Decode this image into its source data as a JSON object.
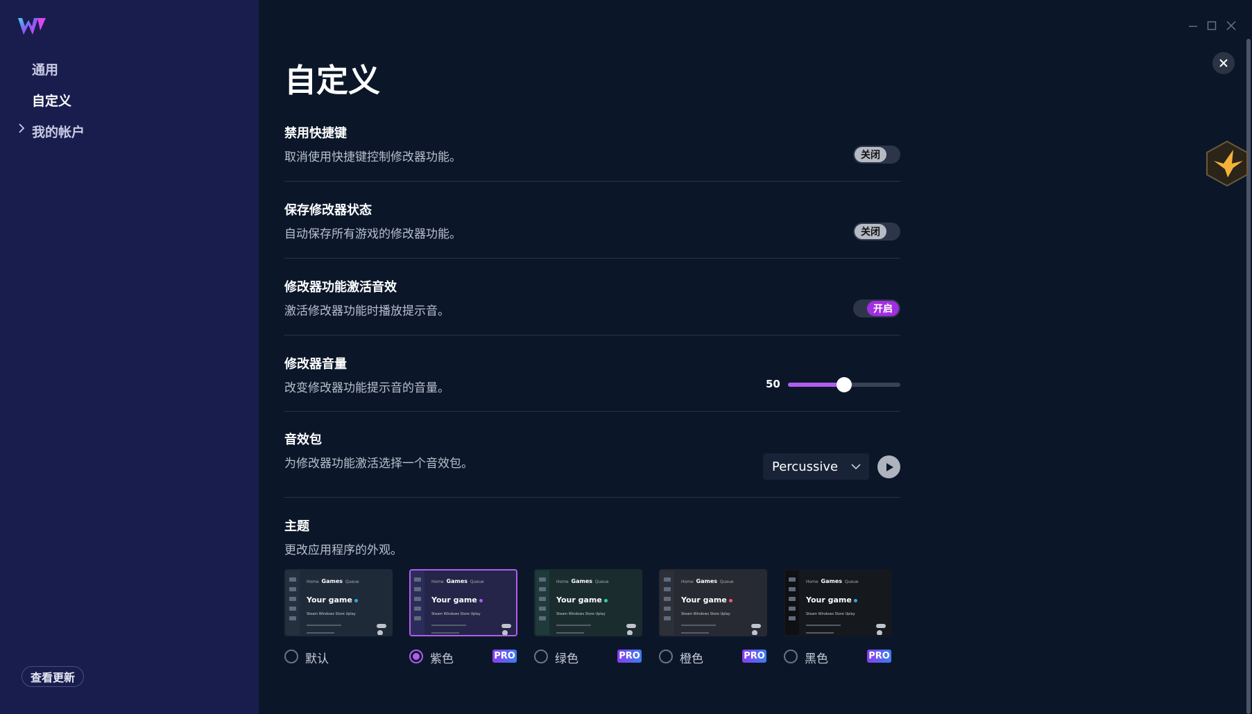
{
  "sidebar": {
    "items": [
      {
        "label": "通用"
      },
      {
        "label": "自定义"
      },
      {
        "label": "我的帐户"
      }
    ],
    "update_button": "查看更新"
  },
  "page": {
    "title": "自定义"
  },
  "settings": {
    "hotkeys": {
      "title": "禁用快捷键",
      "desc": "取消使用快捷键控制修改器功能。",
      "state": "关闭"
    },
    "save_state": {
      "title": "保存修改器状态",
      "desc": "自动保存所有游戏的修改器功能。",
      "state": "关闭"
    },
    "sound": {
      "title": "修改器功能激活音效",
      "desc": "激活修改器功能时播放提示音。",
      "state": "开启"
    },
    "volume": {
      "title": "修改器音量",
      "desc": "改变修改器功能提示音的音量。",
      "value": "50",
      "percent": 50
    },
    "sound_pack": {
      "title": "音效包",
      "desc": "为修改器功能激活选择一个音效包。",
      "selected": "Percussive"
    },
    "theme": {
      "title": "主题",
      "desc": "更改应用程序的外观。",
      "preview": {
        "nav_home": "Home",
        "nav_games": "Games",
        "nav_queue": "Queue",
        "game_title": "Your game",
        "stores": "Steam   Windows Store   Uplay"
      },
      "options": [
        {
          "label": "默认",
          "pro": "",
          "accent": "#2fa8e6",
          "bg": "#1f2a38",
          "side": "#25303f",
          "checked": false
        },
        {
          "label": "紫色",
          "pro": "PRO",
          "accent": "#b25cf0",
          "bg": "#242548",
          "side": "#2c2c5a",
          "checked": true
        },
        {
          "label": "绿色",
          "pro": "PRO",
          "accent": "#2cd6a4",
          "bg": "#1b2c2e",
          "side": "#1f3a3a",
          "checked": false
        },
        {
          "label": "橙色",
          "pro": "PRO",
          "accent": "#ff5a5a",
          "bg": "#272a32",
          "side": "#2d3039",
          "checked": false
        },
        {
          "label": "黑色",
          "pro": "PRO",
          "accent": "#2fa8e6",
          "bg": "#15181c",
          "side": "#0e1013",
          "checked": false
        }
      ]
    }
  }
}
